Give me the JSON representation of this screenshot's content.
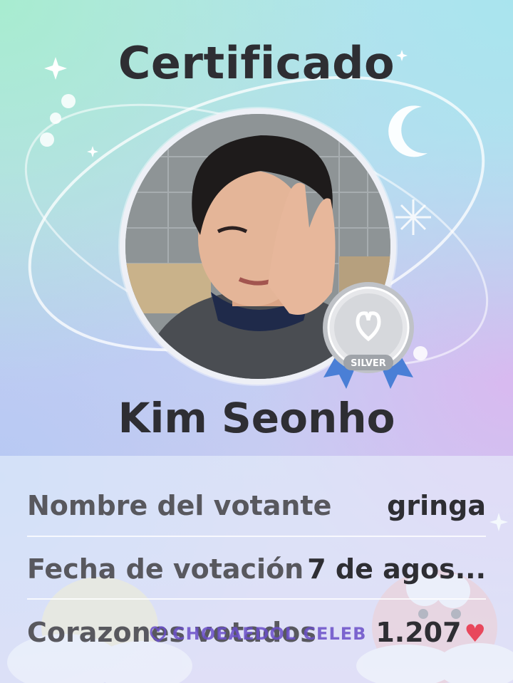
{
  "certificate": {
    "title": "Certificado",
    "celebrity_name": "Kim Seonho",
    "badge": {
      "label": "SILVER",
      "tier": "silver"
    },
    "rows": [
      {
        "label": "Nombre del votante",
        "value": "gringa"
      },
      {
        "label": "Fecha de votación",
        "value": "7 de agos..."
      },
      {
        "label": "Corazones votados",
        "value": "1.207"
      }
    ],
    "heart_icon": "heart-icon",
    "watermark": "CHOEAEDOL CELEB"
  },
  "colors": {
    "heart": "#e8485c",
    "badge_silver": "#c4c7cc",
    "ribbon_blue": "#4a7fd6",
    "watermark_purple": "#6a4fc9"
  }
}
